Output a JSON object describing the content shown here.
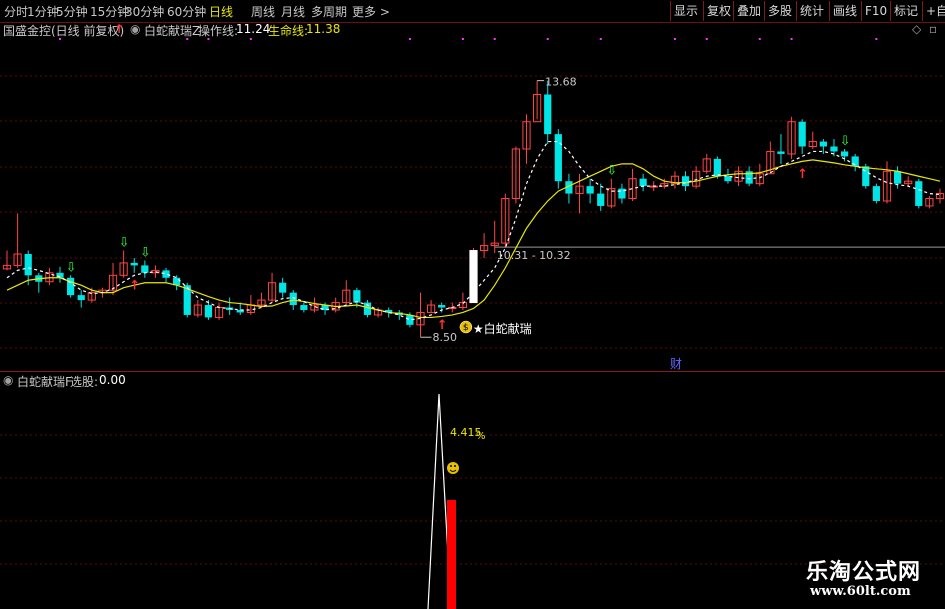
{
  "toolbar": {
    "periods": [
      {
        "label": "分时",
        "active": false
      },
      {
        "label": "1分钟",
        "active": false
      },
      {
        "label": "5分钟",
        "active": false
      },
      {
        "label": "15分钟",
        "active": false
      },
      {
        "label": "30分钟",
        "active": false
      },
      {
        "label": "60分钟",
        "active": false
      },
      {
        "label": "日线",
        "active": true
      },
      {
        "label": "周线",
        "active": false
      },
      {
        "label": "月线",
        "active": false
      },
      {
        "label": "多周期",
        "active": false
      },
      {
        "label": "更多",
        "active": false
      }
    ],
    "actions": [
      "显示",
      "复权",
      "叠加",
      "多股",
      "统计",
      "画线",
      "F10",
      "标记",
      "+自选"
    ]
  },
  "main_panel": {
    "stock_title": "国盛金控(日线 前复权)",
    "indicator_name": "白蛇献瑞Z",
    "op_line_label": "操作线:",
    "op_line_value": "11.24",
    "life_line_label": "生命线:",
    "life_line_value": "11.38",
    "signal_label": "★白蛇献瑞",
    "finance_badge": "财"
  },
  "sub_panel": {
    "indicator_name": "白蛇献瑞F",
    "select_label": "选股:",
    "select_value": "0.00",
    "peak_label": "4.415",
    "peak_unit": "%"
  },
  "watermark": {
    "cn": "乐淘公式网",
    "url": "www.60lt.com"
  },
  "colors": {
    "up": "#ff4444",
    "down": "#00e5e5",
    "op_line": "#ffffff",
    "life_line": "#e8e800",
    "highlight": "#e8e800",
    "bar": "#ff0000"
  },
  "chart_data": {
    "type": "candlestick",
    "y_range": [
      8.0,
      14.5
    ],
    "annotations": {
      "high_label": "13.68",
      "low_label": "8.50",
      "range_label": "10.31 - 10.32",
      "range_level": 10.32
    },
    "candles": [
      [
        9.88,
        9.95,
        10.25,
        9.85
      ],
      [
        9.95,
        10.18,
        11.0,
        9.9
      ],
      [
        10.18,
        9.75,
        10.25,
        9.55
      ],
      [
        9.75,
        9.62,
        9.8,
        9.4
      ],
      [
        9.62,
        9.8,
        9.9,
        9.55
      ],
      [
        9.8,
        9.7,
        9.92,
        9.6
      ],
      [
        9.7,
        9.35,
        9.75,
        9.3
      ],
      [
        9.35,
        9.25,
        9.45,
        9.1
      ],
      [
        9.25,
        9.4,
        9.5,
        9.2
      ],
      [
        9.4,
        9.45,
        9.5,
        9.3
      ],
      [
        9.45,
        9.75,
        10.0,
        9.35
      ],
      [
        9.75,
        10.0,
        10.25,
        9.7
      ],
      [
        10.0,
        9.95,
        10.1,
        9.8
      ],
      [
        9.95,
        9.8,
        10.05,
        9.7
      ],
      [
        9.8,
        9.85,
        9.95,
        9.7
      ],
      [
        9.85,
        9.7,
        9.9,
        9.6
      ],
      [
        9.7,
        9.55,
        9.75,
        9.45
      ],
      [
        9.55,
        8.95,
        9.6,
        8.9
      ],
      [
        8.95,
        9.15,
        9.25,
        8.9
      ],
      [
        9.15,
        8.9,
        9.25,
        8.85
      ],
      [
        8.9,
        9.1,
        9.2,
        8.85
      ],
      [
        9.1,
        9.05,
        9.3,
        8.95
      ],
      [
        9.05,
        9.0,
        9.2,
        8.95
      ],
      [
        9.0,
        9.15,
        9.35,
        8.95
      ],
      [
        9.15,
        9.25,
        9.4,
        9.1
      ],
      [
        9.25,
        9.6,
        9.8,
        9.2
      ],
      [
        9.6,
        9.4,
        9.7,
        9.3
      ],
      [
        9.4,
        9.15,
        9.45,
        9.05
      ],
      [
        9.15,
        9.05,
        9.2,
        9.0
      ],
      [
        9.05,
        9.15,
        9.3,
        9.0
      ],
      [
        9.15,
        9.05,
        9.2,
        8.95
      ],
      [
        9.05,
        9.2,
        9.3,
        9.0
      ],
      [
        9.2,
        9.45,
        9.65,
        9.15
      ],
      [
        9.45,
        9.2,
        9.5,
        9.1
      ],
      [
        9.2,
        8.95,
        9.25,
        8.9
      ],
      [
        8.95,
        9.05,
        9.1,
        8.9
      ],
      [
        9.05,
        9.0,
        9.1,
        8.9
      ],
      [
        9.0,
        8.95,
        9.05,
        8.85
      ],
      [
        8.95,
        8.75,
        9.0,
        8.7
      ],
      [
        8.75,
        9.0,
        9.4,
        8.5
      ],
      [
        9.0,
        9.15,
        9.25,
        9.0
      ],
      [
        9.15,
        9.1,
        9.2,
        9.0
      ],
      [
        9.1,
        9.1,
        9.2,
        9.0
      ],
      [
        9.1,
        9.2,
        9.4,
        9.05
      ],
      [
        9.2,
        10.25,
        10.3,
        9.2
      ],
      [
        10.25,
        10.35,
        10.6,
        10.1
      ],
      [
        10.35,
        10.4,
        10.85,
        10.2
      ],
      [
        10.4,
        11.3,
        11.4,
        10.3
      ],
      [
        11.3,
        12.3,
        12.35,
        11.2
      ],
      [
        12.3,
        12.85,
        13.0,
        12.0
      ],
      [
        12.85,
        13.4,
        13.68,
        12.9
      ],
      [
        13.4,
        12.6,
        13.68,
        12.4
      ],
      [
        12.6,
        11.65,
        12.7,
        11.5
      ],
      [
        11.65,
        11.4,
        11.8,
        11.2
      ],
      [
        11.4,
        11.55,
        11.8,
        11.0
      ],
      [
        11.55,
        11.4,
        11.7,
        11.2
      ],
      [
        11.4,
        11.15,
        11.6,
        11.05
      ],
      [
        11.15,
        11.5,
        11.7,
        11.1
      ],
      [
        11.5,
        11.3,
        11.6,
        11.2
      ],
      [
        11.3,
        11.7,
        11.9,
        11.25
      ],
      [
        11.7,
        11.55,
        11.8,
        11.45
      ],
      [
        11.55,
        11.55,
        11.65,
        11.45
      ],
      [
        11.55,
        11.6,
        11.7,
        11.5
      ],
      [
        11.6,
        11.75,
        11.85,
        11.5
      ],
      [
        11.75,
        11.55,
        11.85,
        11.45
      ],
      [
        11.55,
        11.85,
        11.95,
        11.5
      ],
      [
        11.85,
        12.1,
        12.2,
        11.8
      ],
      [
        12.1,
        11.75,
        12.15,
        11.7
      ],
      [
        11.75,
        11.65,
        11.9,
        11.6
      ],
      [
        11.65,
        11.85,
        11.95,
        11.55
      ],
      [
        11.85,
        11.6,
        11.95,
        11.55
      ],
      [
        11.6,
        11.8,
        12.0,
        11.55
      ],
      [
        11.8,
        12.25,
        12.45,
        11.8
      ],
      [
        12.25,
        12.2,
        12.6,
        12.0
      ],
      [
        12.2,
        12.85,
        12.95,
        12.1
      ],
      [
        12.85,
        12.35,
        12.9,
        12.2
      ],
      [
        12.35,
        12.45,
        12.65,
        12.3
      ],
      [
        12.45,
        12.35,
        12.5,
        12.2
      ],
      [
        12.35,
        12.25,
        12.5,
        12.15
      ],
      [
        12.25,
        12.15,
        12.3,
        12.05
      ],
      [
        12.15,
        11.95,
        12.2,
        11.85
      ],
      [
        11.95,
        11.55,
        12.0,
        11.5
      ],
      [
        11.55,
        11.25,
        11.6,
        11.2
      ],
      [
        11.25,
        11.85,
        12.05,
        11.2
      ],
      [
        11.85,
        11.6,
        11.95,
        11.5
      ],
      [
        11.6,
        11.65,
        11.75,
        11.55
      ],
      [
        11.65,
        11.15,
        11.7,
        11.1
      ],
      [
        11.15,
        11.3,
        11.35,
        11.1
      ],
      [
        11.3,
        11.4,
        11.5,
        11.2
      ]
    ],
    "life_line": [
      9.45,
      9.55,
      9.65,
      9.68,
      9.7,
      9.7,
      9.62,
      9.55,
      9.45,
      9.4,
      9.4,
      9.5,
      9.55,
      9.6,
      9.6,
      9.6,
      9.55,
      9.48,
      9.4,
      9.32,
      9.25,
      9.2,
      9.18,
      9.15,
      9.12,
      9.13,
      9.2,
      9.25,
      9.22,
      9.18,
      9.15,
      9.12,
      9.13,
      9.15,
      9.1,
      9.05,
      9.0,
      8.98,
      8.95,
      8.9,
      8.9,
      8.92,
      8.95,
      9.0,
      9.08,
      9.25,
      9.55,
      9.9,
      10.3,
      10.7,
      11.0,
      11.25,
      11.45,
      11.55,
      11.65,
      11.75,
      11.85,
      11.95,
      12.0,
      12.0,
      11.9,
      11.75,
      11.65,
      11.62,
      11.62,
      11.65,
      11.7,
      11.75,
      11.78,
      11.8,
      11.8,
      11.82,
      11.88,
      11.95,
      12.0,
      12.05,
      12.08,
      12.05,
      12.02,
      11.98,
      11.95,
      11.92,
      11.9,
      11.88,
      11.85,
      11.8,
      11.75,
      11.7,
      11.65
    ],
    "op_line": [
      9.7,
      9.85,
      9.9,
      9.85,
      9.78,
      9.72,
      9.6,
      9.45,
      9.38,
      9.4,
      9.48,
      9.62,
      9.75,
      9.8,
      9.82,
      9.78,
      9.7,
      9.5,
      9.3,
      9.2,
      9.1,
      9.08,
      9.05,
      9.05,
      9.1,
      9.2,
      9.28,
      9.3,
      9.22,
      9.12,
      9.05,
      9.08,
      9.15,
      9.22,
      9.15,
      9.05,
      9.0,
      8.95,
      8.85,
      8.88,
      8.95,
      9.05,
      9.1,
      9.18,
      9.4,
      9.65,
      9.9,
      10.3,
      10.9,
      11.6,
      12.1,
      12.45,
      12.45,
      12.25,
      11.95,
      11.7,
      11.55,
      11.45,
      11.45,
      11.5,
      11.55,
      11.55,
      11.55,
      11.58,
      11.62,
      11.68,
      11.75,
      11.78,
      11.75,
      11.72,
      11.7,
      11.72,
      11.82,
      11.95,
      12.05,
      12.15,
      12.25,
      12.25,
      12.2,
      12.1,
      11.98,
      11.85,
      11.72,
      11.62,
      11.58,
      11.55,
      11.48,
      11.4,
      11.38
    ]
  }
}
